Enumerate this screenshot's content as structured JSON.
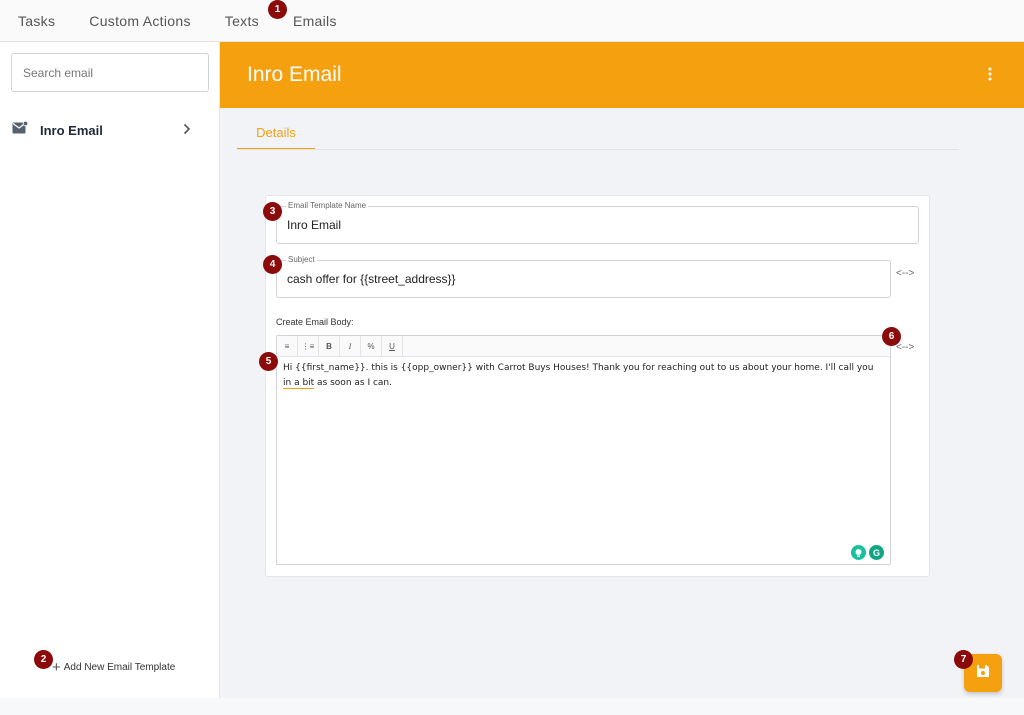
{
  "topnav": {
    "tabs": [
      {
        "label": "Tasks"
      },
      {
        "label": "Custom Actions"
      },
      {
        "label": "Texts"
      },
      {
        "label": "Emails"
      }
    ]
  },
  "sidebar": {
    "search_placeholder": "Search email",
    "items": [
      {
        "label": "Inro Email",
        "icon": "email-icon"
      }
    ],
    "add_label": "Add New Email Template"
  },
  "header": {
    "title": "Inro Email"
  },
  "tabs": {
    "details": "Details"
  },
  "form": {
    "name_label": "Email Template Name",
    "name_value": "Inro Email",
    "subject_label": "Subject",
    "subject_value": "cash offer for {{street_address}}",
    "vars_icon": "<-->",
    "body_label": "Create Email Body:",
    "body_part1": "Hi {{first_name}}. this is {{opp_owner}} with Carrot Buys Houses! Thank you for reaching out to us about your home. I'll call you ",
    "body_underlined": "in a bit",
    "body_part2": " as soon as I can."
  },
  "toolbar": {
    "buttons": [
      "≡",
      "⋮≡",
      "B",
      "I",
      "%",
      "U"
    ]
  },
  "badges": [
    "1",
    "2",
    "3",
    "4",
    "5",
    "6",
    "7"
  ],
  "colors": {
    "accent": "#f5a00f",
    "badge": "#8b0b0b",
    "grammarly": "#15c39a"
  }
}
